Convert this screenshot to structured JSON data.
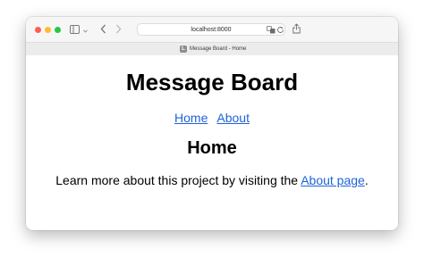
{
  "browser": {
    "address": "localhost:8000",
    "tab_title": "Message Board - Home",
    "tab_favicon_letter": "L",
    "icons": {
      "sidebar": "sidebar-icon",
      "sidebar_menu": "chevron-down-icon",
      "back": "chevron-left-icon",
      "forward": "chevron-right-icon",
      "translate": "translate-icon",
      "reload": "reload-icon",
      "share": "share-icon"
    },
    "colors": {
      "close": "#ff5f57",
      "minimize": "#febc2e",
      "zoom": "#28c840"
    }
  },
  "page": {
    "title": "Message Board",
    "nav": {
      "home": "Home",
      "about": "About"
    },
    "heading": "Home",
    "paragraph": {
      "before": "Learn more about this project by visiting the ",
      "link": "About page",
      "after": "."
    },
    "link_color": "#1d63d8"
  }
}
